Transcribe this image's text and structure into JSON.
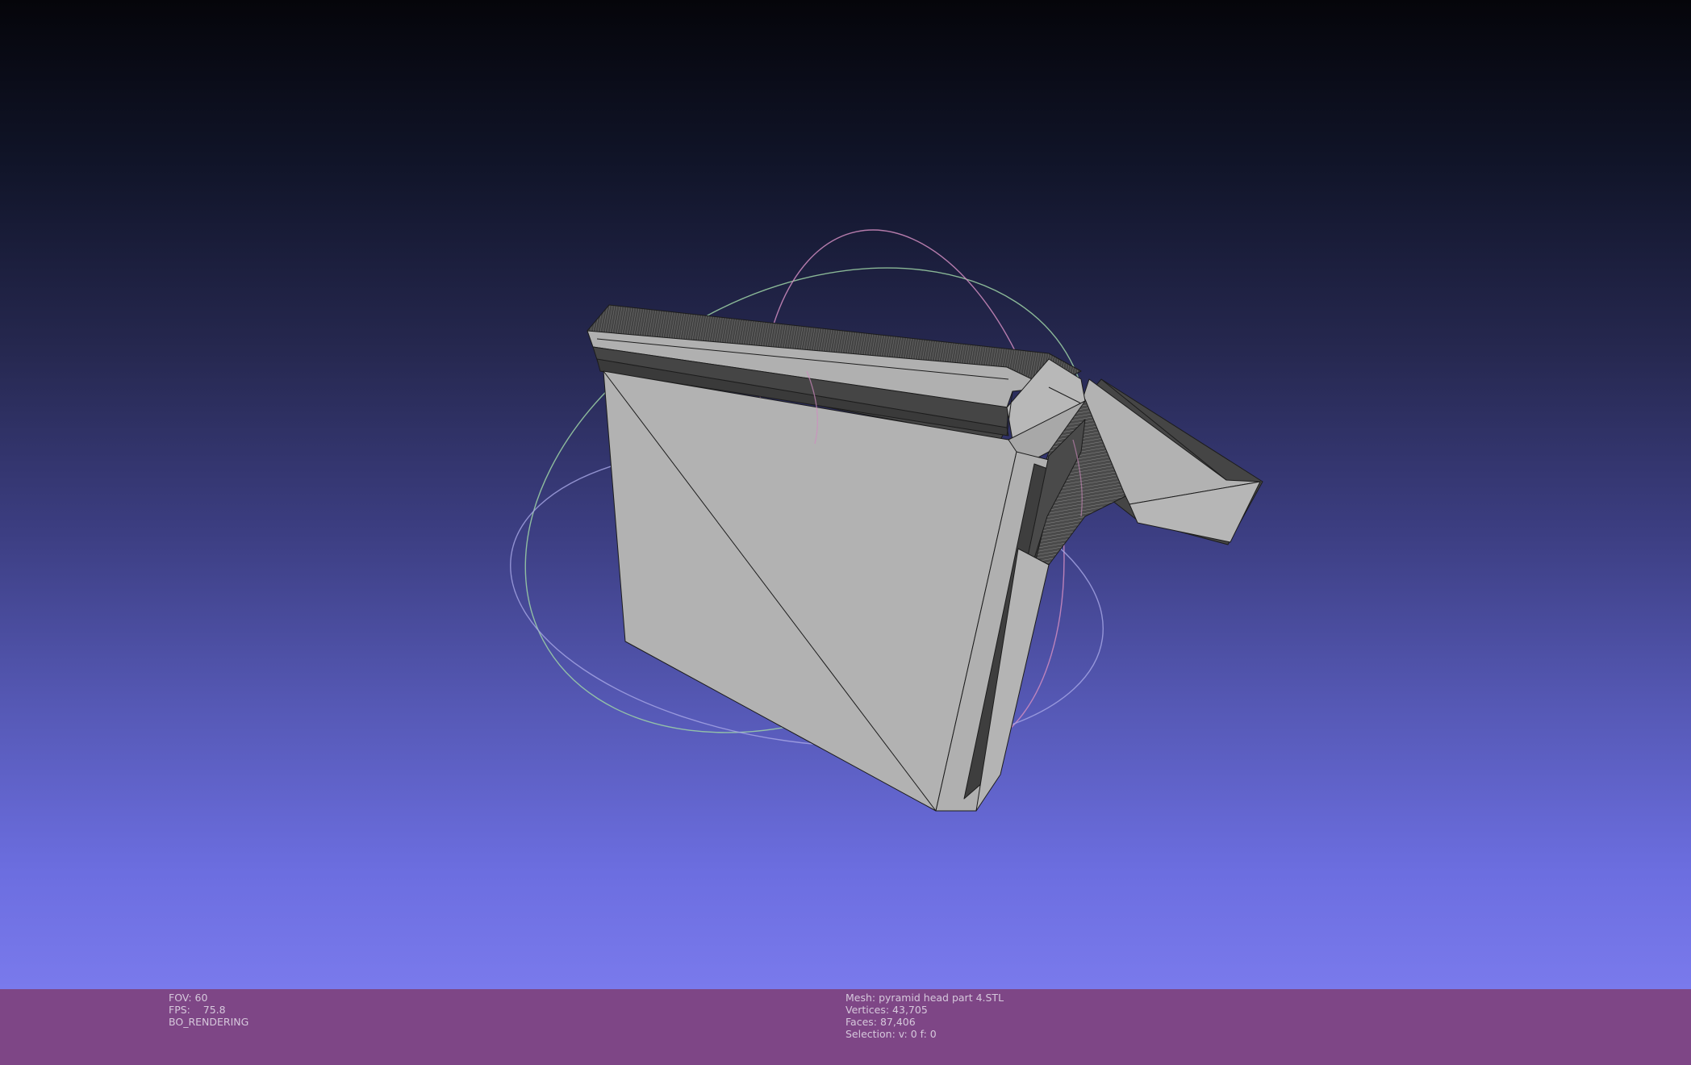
{
  "viewer": {
    "app": "MeshLab 3D viewport",
    "background_gradient_colors": [
      "#05050a",
      "#262850",
      "#5558b4",
      "#7d7ff0"
    ],
    "mesh_colors": {
      "face": "#b2b2b2",
      "shadow": "#454545",
      "edge": "#1c1c1c"
    },
    "trackball_ring_colors": {
      "x": "#d08cc0",
      "y": "#9ed2a6",
      "z": "#a8a8e6"
    }
  },
  "info_bar": {
    "background": "#7e4686",
    "left": {
      "fov": "FOV: 60",
      "fps": "FPS:    75.8",
      "mode": "BO_RENDERING"
    },
    "right": {
      "mesh": "Mesh: pyramid head part 4.STL",
      "vertices": "Vertices: 43,705",
      "faces": "Faces: 87,406",
      "selection": "Selection: v: 0 f: 0"
    }
  }
}
